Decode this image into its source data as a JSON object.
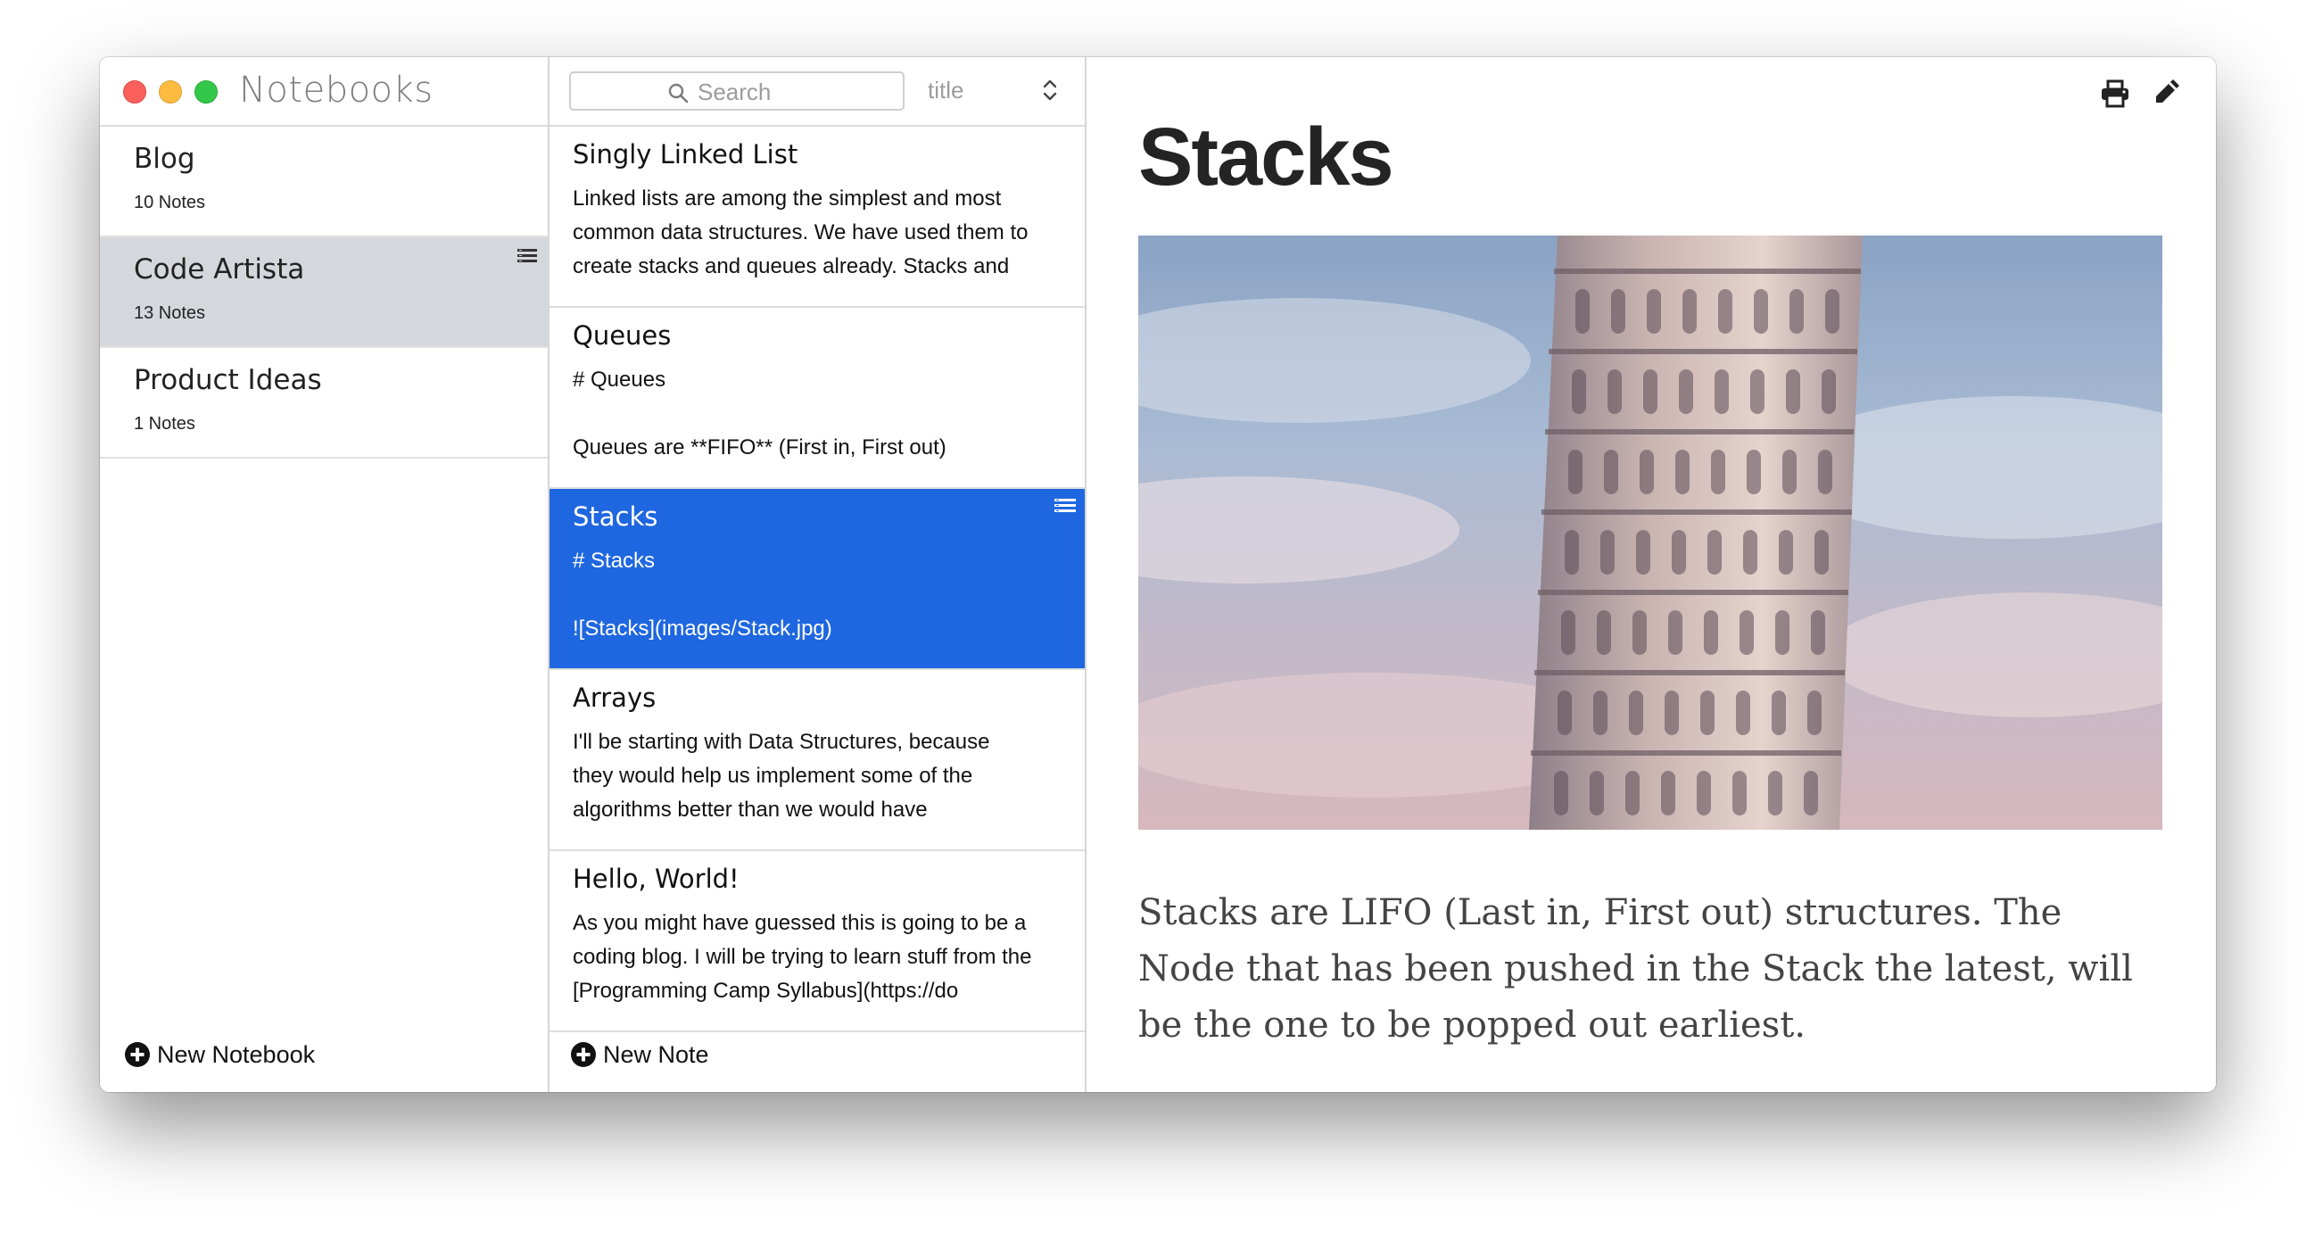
{
  "window": {
    "title": "Notebooks"
  },
  "notebooks": [
    {
      "name": "Blog",
      "count": "10 Notes"
    },
    {
      "name": "Code Artista",
      "count": "13 Notes"
    },
    {
      "name": "Product Ideas",
      "count": "1 Notes"
    }
  ],
  "notebooks_footer": {
    "new_label": "New Notebook"
  },
  "search": {
    "placeholder": "Search"
  },
  "sort": {
    "label": "title"
  },
  "notes": [
    {
      "title": "Singly Linked List",
      "preview": "Linked lists are among the simplest and most\ncommon data structures. We have used them to\ncreate stacks and queues already. Stacks and"
    },
    {
      "title": "Queues",
      "preview": "# Queues\n\nQueues are **FIFO** (First in, First out)"
    },
    {
      "title": "Stacks",
      "preview": "# Stacks\n\n![Stacks](images/Stack.jpg)"
    },
    {
      "title": "Arrays",
      "preview": "I'll be starting with Data Structures, because\nthey would help us implement some of the\nalgorithms better than we would have"
    },
    {
      "title": "Hello, World!",
      "preview": "As you might have guessed this is going to be a\ncoding blog. I will be trying to learn stuff from the\n[Programming Camp Syllabus](https://do"
    }
  ],
  "notes_footer": {
    "new_label": "New Note"
  },
  "document": {
    "title": "Stacks",
    "body": "Stacks are LIFO (Last in, First out) structures. The Node that has been pushed in the Stack the latest, will be the one to be popped out earliest."
  },
  "icons": {
    "print": "printer-icon",
    "edit": "pencil-icon",
    "search": "search-icon",
    "add": "plus-circle-icon",
    "sort": "updown-chevron-icon",
    "note_menu": "list-menu-icon"
  },
  "colors": {
    "selected_note_bg": "#1f67e0",
    "selected_notebook_bg": "#d4d7dc",
    "close": "#fc605c",
    "minimize": "#fdbc40",
    "zoom": "#34c84a"
  }
}
